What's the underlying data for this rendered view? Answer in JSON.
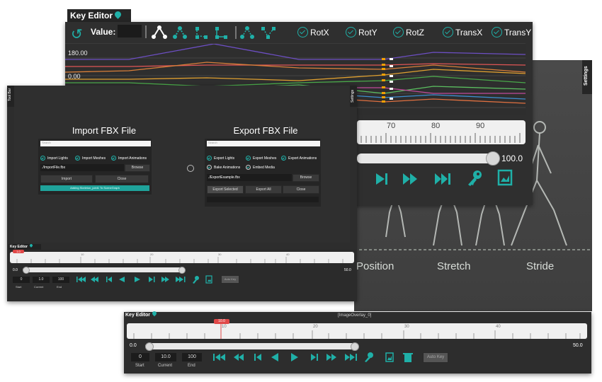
{
  "key_editor_top": {
    "tab_label": "Key Editor",
    "value_label": "Value:",
    "value_input": "",
    "channels": [
      "RotX",
      "RotY",
      "RotZ",
      "TransX",
      "TransY"
    ],
    "graph_top_label": "180.00",
    "graph_zero_label": "0.00",
    "timeline_labels": [
      "70",
      "80",
      "90"
    ],
    "slider_value": "100.0"
  },
  "settings_tab_label": "Settings",
  "background_labels": [
    "Position",
    "Stretch",
    "Stride"
  ],
  "fbx_window": {
    "side_tab_left": "Tool Bar",
    "side_tab_right": "Settings",
    "import": {
      "title": "Import FBX File",
      "search_placeholder": "Search",
      "checks": [
        "Import Lights",
        "Import Meshes",
        "Import Animations"
      ],
      "file_path": "./ImportFile.fbx",
      "browse_label": "Browse",
      "import_label": "Import",
      "close_label": "Close",
      "status": "Adding Skeleton_joint1 To SceneGraph"
    },
    "export": {
      "title": "Export FBX File",
      "search_placeholder": "Search",
      "checks_row1": [
        "Export Lights",
        "Export Meshes",
        "Export Animations"
      ],
      "checks_row2": [
        "Bake Animations",
        "Embed Media"
      ],
      "file_path": "./ExportExample.fbx",
      "browse_label": "Browse",
      "export_selected_label": "Export Selected",
      "export_all_label": "Export All",
      "close_label": "Close"
    },
    "key_editor": {
      "tab_label": "Key Editor",
      "playhead_label": "1.0",
      "ruler_labels": [
        "10",
        "20",
        "30",
        "40"
      ],
      "range_start": "0.0",
      "range_end": "50.0",
      "start_value": "0",
      "current_value": "1.0",
      "end_value": "100",
      "start_label": "Start",
      "current_label": "Current",
      "end_label": "End",
      "auto_key_label": "Auto Key"
    }
  },
  "key_editor_bottom": {
    "tab_label": "Key Editor",
    "overlay_label": "[ImageOverlay_0]",
    "playhead_label": "10.0",
    "ruler_labels": [
      "10",
      "20",
      "30",
      "40"
    ],
    "range_start": "0.0",
    "range_end": "50.0",
    "start_value": "0",
    "current_value": "10.0",
    "end_value": "100",
    "start_label": "Start",
    "current_label": "Current",
    "end_label": "End",
    "auto_key_label": "Auto Key"
  },
  "colors": {
    "accent": "#1fb0a8",
    "panel": "#2b2b2b",
    "graph_bg": "#2e2e2e"
  },
  "icons": [
    "undo-icon",
    "curve-icon",
    "key-icon",
    "save-icon",
    "delete-icon",
    "play-icon",
    "step-icon",
    "fast-forward-icon"
  ]
}
